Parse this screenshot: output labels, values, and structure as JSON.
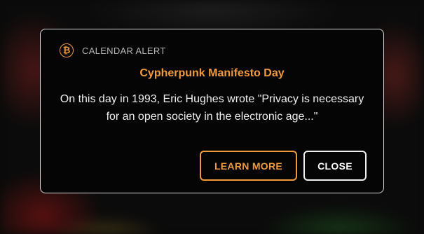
{
  "alert": {
    "header_icon": "bitcoin-icon",
    "header_icon_glyph": "₿",
    "header_label": "CALENDAR ALERT",
    "title": "Cypherpunk Manifesto Day",
    "message": "On this day in 1993, Eric Hughes wrote \"Privacy is necessary for an open society in the electronic age...\""
  },
  "actions": {
    "learn_more_label": "LEARN MORE",
    "close_label": "CLOSE"
  },
  "colors": {
    "accent": "#f09a3e",
    "dialog_background": "#050505",
    "dialog_border": "#d9d9d9",
    "text": "#eeeeee"
  }
}
